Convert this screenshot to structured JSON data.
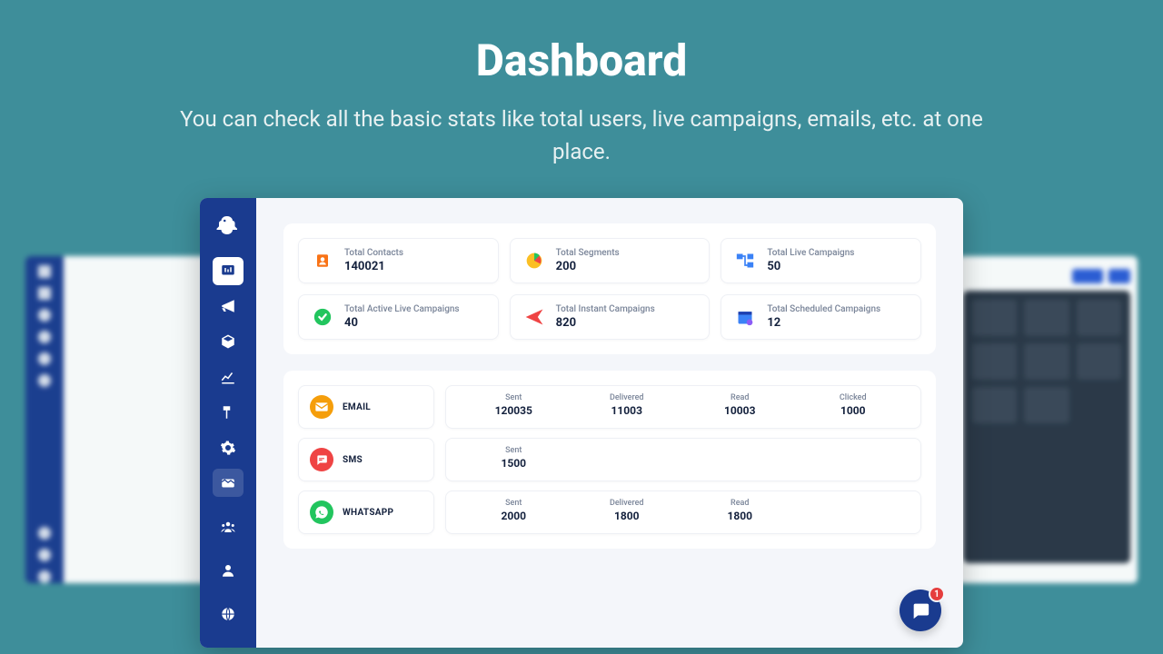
{
  "hero": {
    "title": "Dashboard",
    "subtitle": "You can check all the basic stats like total users, live campaigns, emails, etc. at one place."
  },
  "stats": [
    {
      "label": "Total Contacts",
      "value": "140021",
      "icon": "contacts",
      "color": "#f97316"
    },
    {
      "label": "Total Segments",
      "value": "200",
      "icon": "pie",
      "color": "#f59e0b"
    },
    {
      "label": "Total Live Campaigns",
      "value": "50",
      "icon": "flow",
      "color": "#3b82f6"
    },
    {
      "label": "Total Active Live Campaigns",
      "value": "40",
      "icon": "check",
      "color": "#22c55e"
    },
    {
      "label": "Total Instant Campaigns",
      "value": "820",
      "icon": "send",
      "color": "#ef4444"
    },
    {
      "label": "Total Scheduled Campaigns",
      "value": "12",
      "icon": "calendar",
      "color": "#3b82f6"
    }
  ],
  "channels": [
    {
      "name": "EMAIL",
      "icon": "email",
      "color": "#f59e0b",
      "metrics": [
        {
          "label": "Sent",
          "value": "120035"
        },
        {
          "label": "Delivered",
          "value": "11003"
        },
        {
          "label": "Read",
          "value": "10003"
        },
        {
          "label": "Clicked",
          "value": "1000"
        }
      ]
    },
    {
      "name": "SMS",
      "icon": "sms",
      "color": "#ef4444",
      "metrics": [
        {
          "label": "Sent",
          "value": "1500"
        }
      ]
    },
    {
      "name": "WHATSAPP",
      "icon": "whatsapp",
      "color": "#22c55e",
      "metrics": [
        {
          "label": "Sent",
          "value": "2000"
        },
        {
          "label": "Delivered",
          "value": "1800"
        },
        {
          "label": "Read",
          "value": "1800"
        }
      ]
    }
  ],
  "chat": {
    "badge": "1"
  }
}
